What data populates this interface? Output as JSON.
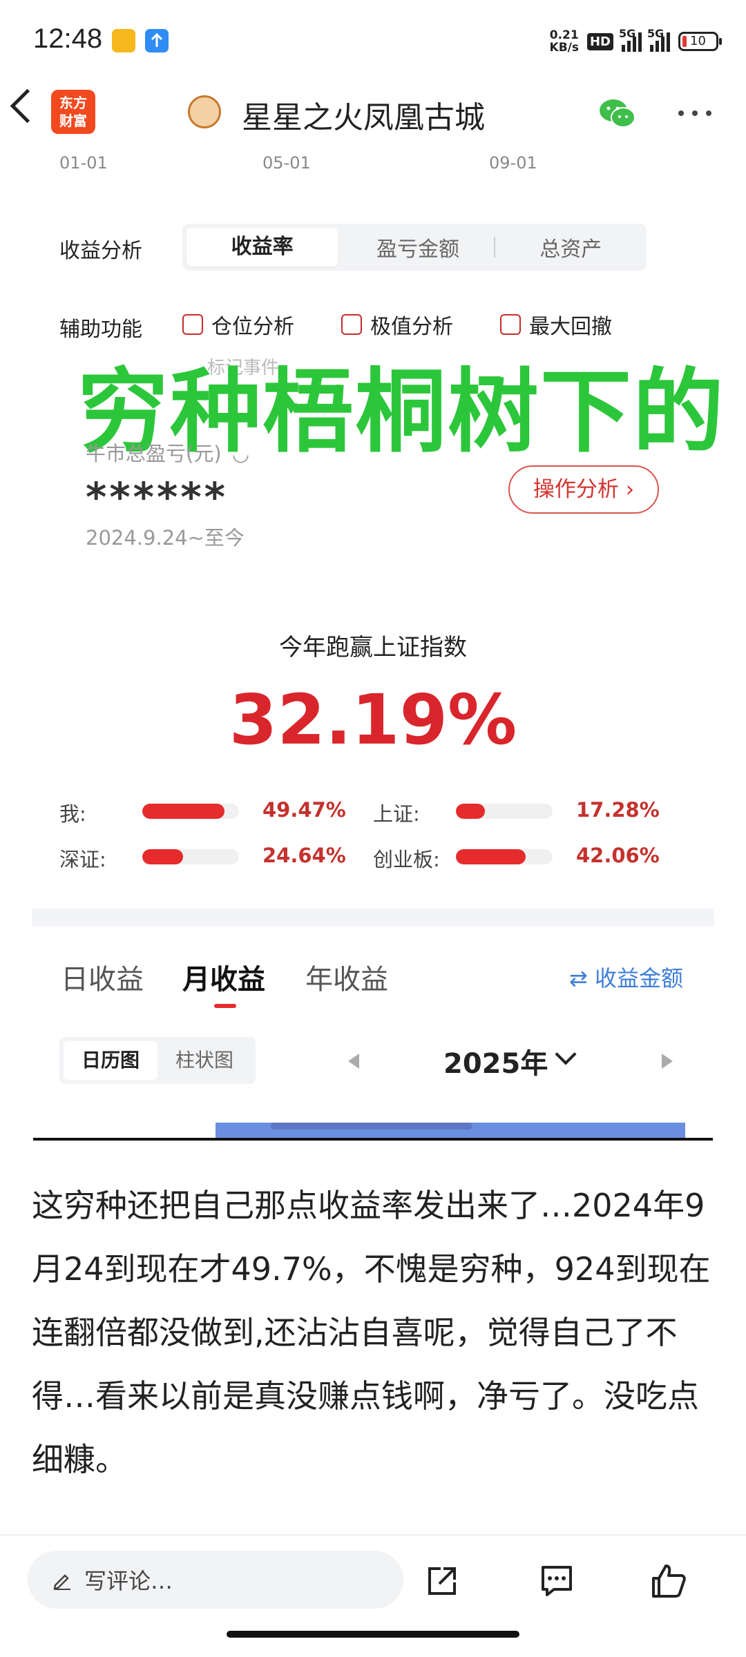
{
  "status_bar": {
    "time": "12:48",
    "net_speed_value": "0.21",
    "net_speed_unit": "KB/s",
    "hd_label": "HD",
    "signal1_label": "5G",
    "signal2_label": "5G",
    "battery": "10"
  },
  "nav": {
    "logo_line1": "东方",
    "logo_line2": "财富",
    "title": "星星之火凤凰古城"
  },
  "axis_dates": [
    "01-01",
    "05-01",
    "09-01"
  ],
  "analysis": {
    "label": "收益分析",
    "tabs": [
      "收益率",
      "盈亏金额",
      "总资产"
    ],
    "active_tab": "收益率"
  },
  "aux": {
    "label": "辅助功能",
    "options": [
      "仓位分析",
      "极值分析",
      "最大回撤"
    ]
  },
  "overlay_text": "穷种梧桐树下的",
  "ghost_tag": "标记事件",
  "pnl": {
    "label": "牛市总盈亏(元)",
    "value": "******",
    "range": "2024.9.24~至今",
    "op_button": "操作分析 ›"
  },
  "beat": {
    "title": "今年跑赢上证指数",
    "value": "32.19%"
  },
  "comparisons": [
    {
      "label": "我:",
      "value": "49.47%",
      "fill": 0.85
    },
    {
      "label": "上证:",
      "value": "17.28%",
      "fill": 0.3
    },
    {
      "label": "深证:",
      "value": "24.64%",
      "fill": 0.42
    },
    {
      "label": "创业板:",
      "value": "42.06%",
      "fill": 0.72
    }
  ],
  "period_tabs": [
    "日收益",
    "月收益",
    "年收益"
  ],
  "active_period": "月收益",
  "swap_link": "⇄ 收益金额",
  "view_modes": [
    "日历图",
    "柱状图"
  ],
  "active_view": "日历图",
  "year_label": "2025年",
  "post_text": "这穷种还把自己那点收益率发出来了…2024年9月24到现在才49.7%，不愧是穷种，924到现在连翻倍都没做到,还沾沾自喜呢，觉得自己了不得…看来以前是真没赚点钱啊，净亏了。没吃点细糠。",
  "bottom": {
    "comment_placeholder": "写评论…"
  },
  "colors": {
    "accent_red": "#e52b2b",
    "overlay_green": "#2cc63a",
    "link_blue": "#3d7ed8",
    "brand_orange": "#f24a1f"
  }
}
